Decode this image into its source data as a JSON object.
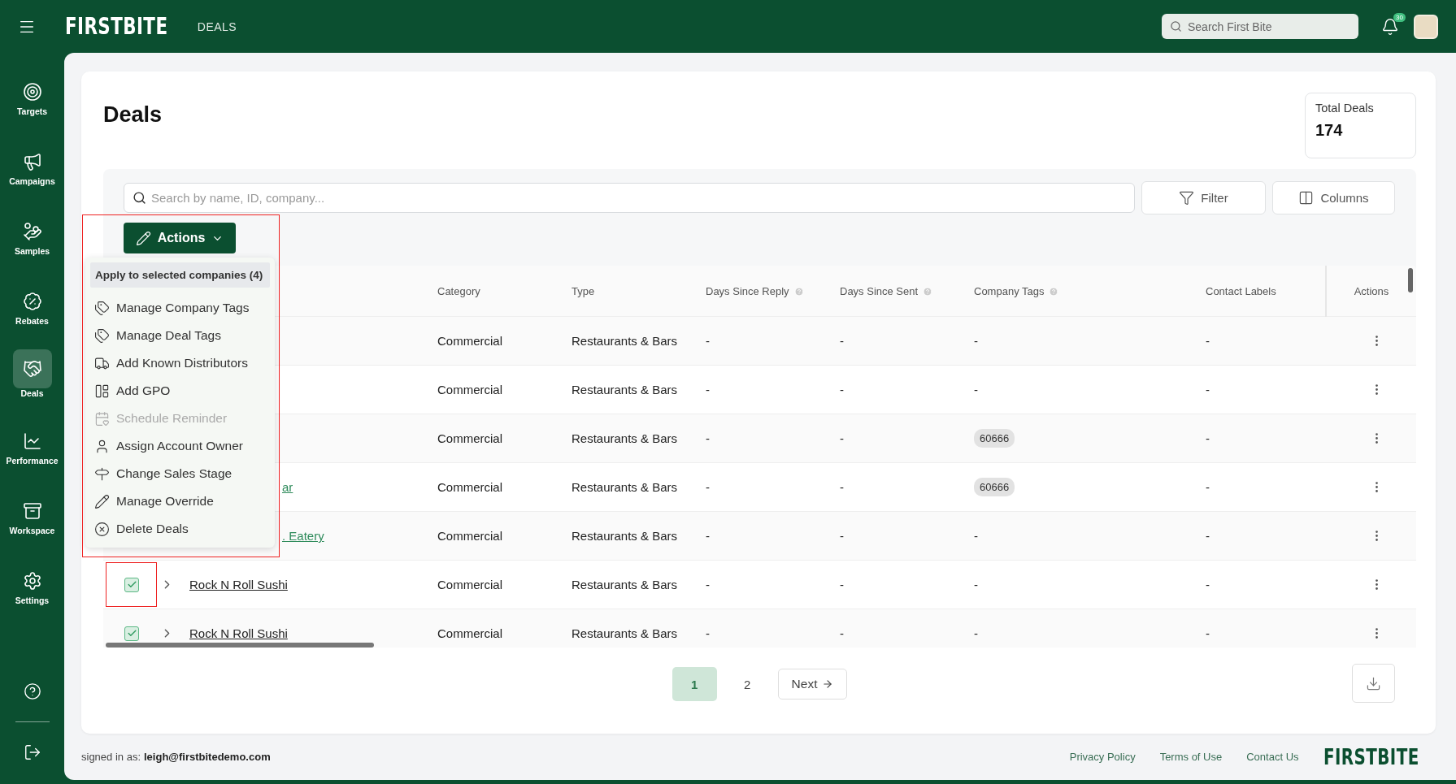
{
  "topbar": {
    "logo": "FIRSTBITE",
    "section": "DEALS",
    "search": {
      "placeholder": "Search First Bite"
    },
    "notification_count": "30"
  },
  "sidebar": {
    "items": [
      {
        "label": "Targets",
        "selected": false
      },
      {
        "label": "Campaigns",
        "selected": false
      },
      {
        "label": "Samples",
        "selected": false
      },
      {
        "label": "Rebates",
        "selected": false
      },
      {
        "label": "Deals",
        "selected": true
      },
      {
        "label": "Performance",
        "selected": false
      },
      {
        "label": "Workspace",
        "selected": false
      },
      {
        "label": "Settings",
        "selected": false
      }
    ]
  },
  "page": {
    "title": "Deals",
    "total": {
      "label": "Total Deals",
      "value": "174"
    }
  },
  "toolbar": {
    "search": {
      "placeholder": "Search by name, ID, company..."
    },
    "filter": "Filter",
    "columns": "Columns",
    "actions": "Actions"
  },
  "actions_menu": {
    "header": "Apply to selected companies (4)",
    "items": [
      {
        "label": "Manage Company Tags",
        "disabled": false
      },
      {
        "label": "Manage Deal Tags",
        "disabled": false
      },
      {
        "label": "Add Known Distributors",
        "disabled": false
      },
      {
        "label": "Add GPO",
        "disabled": false
      },
      {
        "label": "Schedule Reminder",
        "disabled": true
      },
      {
        "label": "Assign Account Owner",
        "disabled": false
      },
      {
        "label": "Change Sales Stage",
        "disabled": false
      },
      {
        "label": "Manage Override",
        "disabled": false
      },
      {
        "label": "Delete Deals",
        "disabled": false
      }
    ]
  },
  "table": {
    "columns": [
      "Category",
      "Type",
      "Days Since Reply",
      "Days Since Sent",
      "Company Tags",
      "Contact Labels",
      "Actions"
    ],
    "rows": [
      {
        "category": "Commercial",
        "type": "Restaurants & Bars",
        "days_since_reply": "-",
        "days_since_sent": "-",
        "company_tags": "-",
        "contact_labels": "-"
      },
      {
        "category": "Commercial",
        "type": "Restaurants & Bars",
        "days_since_reply": "-",
        "days_since_sent": "-",
        "company_tags": "-",
        "contact_labels": "-"
      },
      {
        "category": "Commercial",
        "type": "Restaurants & Bars",
        "days_since_reply": "-",
        "days_since_sent": "-",
        "tag": "60666",
        "contact_labels": "-"
      },
      {
        "name": "ar",
        "category": "Commercial",
        "type": "Restaurants & Bars",
        "days_since_reply": "-",
        "days_since_sent": "-",
        "tag": "60666",
        "contact_labels": "-"
      },
      {
        "name": ". Eatery",
        "category": "Commercial",
        "type": "Restaurants & Bars",
        "days_since_reply": "-",
        "days_since_sent": "-",
        "company_tags": "-",
        "contact_labels": "-"
      },
      {
        "checked": true,
        "name": "Rock N Roll Sushi",
        "category": "Commercial",
        "type": "Restaurants & Bars",
        "days_since_reply": "-",
        "days_since_sent": "-",
        "company_tags": "-",
        "contact_labels": "-"
      },
      {
        "checked": true,
        "name": "Rock N Roll Sushi",
        "category": "Commercial",
        "type": "Restaurants & Bars",
        "days_since_reply": "-",
        "days_since_sent": "-",
        "company_tags": "-",
        "contact_labels": "-"
      }
    ]
  },
  "pagination": {
    "pages": [
      {
        "label": "1",
        "selected": true
      },
      {
        "label": "2",
        "selected": false
      }
    ],
    "next": "Next"
  },
  "footer": {
    "signed_in_label": "signed in as:",
    "email": "leigh@firstbitedemo.com",
    "links": [
      "Privacy Policy",
      "Terms of Use",
      "Contact Us"
    ],
    "logo": "FIRSTBITE"
  }
}
